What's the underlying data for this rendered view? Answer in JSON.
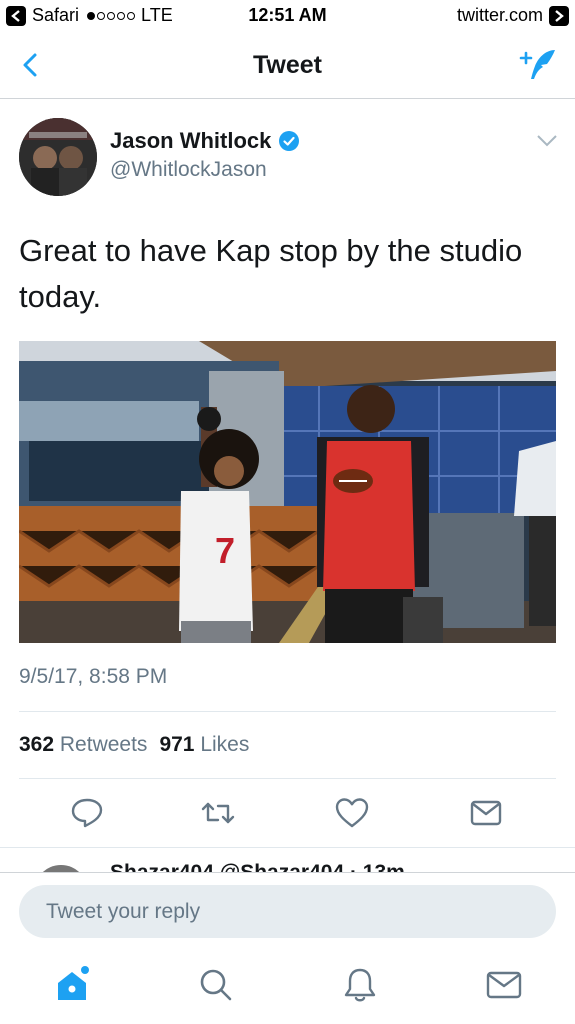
{
  "status_bar": {
    "back_app": "Safari",
    "carrier": "LTE",
    "time": "12:51 AM",
    "domain": "twitter.com"
  },
  "nav": {
    "title": "Tweet",
    "back_icon": "chevron-left-icon",
    "compose_icon": "compose-tweet-icon"
  },
  "tweet": {
    "author_name": "Jason Whitlock",
    "author_handle": "@WhitlockJason",
    "verified": true,
    "text": "Great to have Kap stop by the studio today.",
    "timestamp": "9/5/17, 8:58 PM",
    "retweets_count": "362",
    "retweets_label": "Retweets",
    "likes_count": "971",
    "likes_label": "Likes"
  },
  "actions": [
    {
      "name": "reply-icon"
    },
    {
      "name": "retweet-icon"
    },
    {
      "name": "like-icon"
    },
    {
      "name": "share-icon"
    }
  ],
  "next_reply": {
    "preview_text": "Shazar404 @Shazar404 · 13m"
  },
  "reply": {
    "placeholder": "Tweet your reply"
  },
  "tab_bar": [
    {
      "name": "home-icon",
      "active": true
    },
    {
      "name": "search-icon",
      "active": false
    },
    {
      "name": "notifications-icon",
      "active": false
    },
    {
      "name": "messages-icon",
      "active": false
    }
  ],
  "colors": {
    "accent": "#1da1f2",
    "icon_gray": "#657786",
    "divider": "#e1e8ed",
    "verified": "#1da1f2"
  }
}
